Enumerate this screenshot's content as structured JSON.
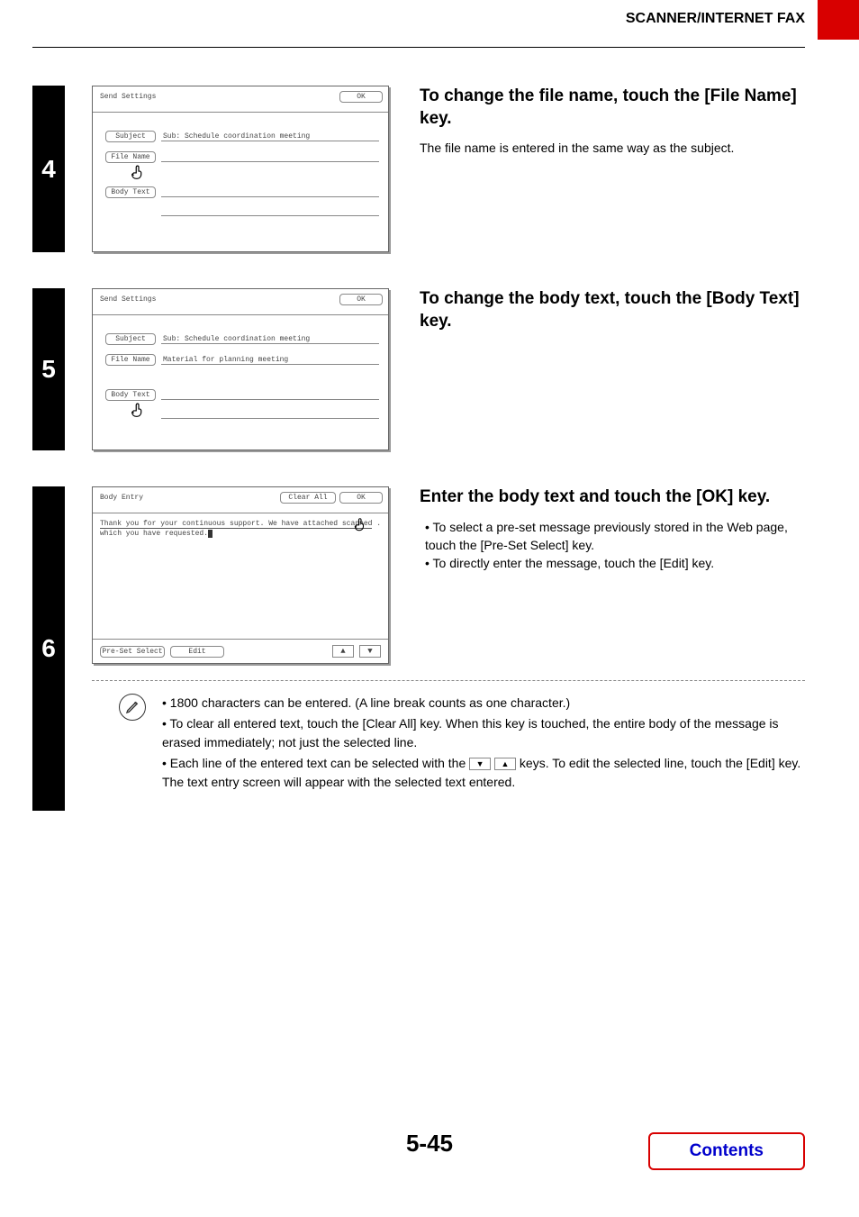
{
  "header": {
    "title": "SCANNER/INTERNET FAX"
  },
  "steps": {
    "s4": {
      "num": "4",
      "panel": {
        "title": "Send Settings",
        "ok": "OK",
        "subject_key": "Subject",
        "subject_val": "Sub: Schedule coordination meeting",
        "filename_key": "File Name",
        "bodytext_key": "Body Text"
      },
      "heading": "To change the file name, touch the [File Name] key.",
      "body": "The file name is entered in the same way as the subject."
    },
    "s5": {
      "num": "5",
      "panel": {
        "title": "Send Settings",
        "ok": "OK",
        "subject_key": "Subject",
        "subject_val": "Sub: Schedule coordination meeting",
        "filename_key": "File Name",
        "filename_val": "Material for planning meeting",
        "bodytext_key": "Body Text"
      },
      "heading": "To change the body text, touch the [Body Text] key."
    },
    "s6": {
      "num": "6",
      "panel": {
        "title": "Body Entry",
        "clear_all": "Clear All",
        "ok": "OK",
        "body_line1": "Thank you for your continuous support. We have attached scanned",
        "body_line2_a": "which you have requested.",
        "preset": "Pre-Set Select",
        "edit": "Edit",
        "up": "▲",
        "down": "▼"
      },
      "heading": "Enter the body text and touch the [OK] key.",
      "bullets": [
        "To select a pre-set message previously stored in the Web page, touch the [Pre-Set Select] key.",
        "To directly enter the message, touch the [Edit] key."
      ],
      "notes": {
        "n1": "1800 characters can be entered. (A line break counts as one character.)",
        "n2": "To clear all entered text, touch the [Clear All] key. When this key is touched, the entire body of the message is erased immediately; not just the selected line.",
        "n3a": "Each line of the entered text can be selected with the ",
        "n3b": " keys. To edit the selected line, touch the [Edit] key. The text entry screen will appear with the selected text entered.",
        "down": "▼",
        "up": "▲"
      }
    }
  },
  "footer": {
    "page": "5-45",
    "contents": "Contents"
  }
}
